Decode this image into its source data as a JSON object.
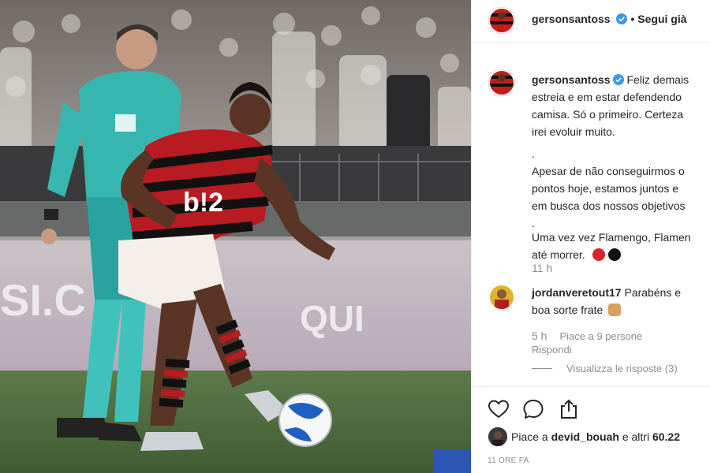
{
  "post": {
    "author": "gersonsantoss",
    "follow_status": "• Segui già",
    "caption_lines": [
      "gersonsantoss",
      "Feliz demais",
      "estreia e em estar defendendo",
      "camisa. Só o primeiro. Certeza",
      "irei evoluir muito.",
      ".",
      "Apesar de não conseguirmos o",
      "pontos hoje, estamos juntos e",
      "em busca dos nossos objetivos",
      ".",
      "Uma vez vez Flamengo, Flamen",
      "até morrer."
    ],
    "caption_time": "11 h",
    "likes_prefix": "Piace a ",
    "likes_user": "devid_bouah",
    "likes_suffix": " e altri ",
    "likes_count": "60.22",
    "posted_ago": "11 ORE FA"
  },
  "comment": {
    "author": "jordanveretout17",
    "text_line1": "Parabéns e",
    "text_line2": "boa sorte frate",
    "time": "5 h",
    "likes": "Piace a 9 persone",
    "reply": "Rispondi",
    "view_replies": "Visualizza le risposte (3)"
  },
  "colors": {
    "verified": "#3897f0",
    "flamengo_red": "#c21e1e",
    "flamengo_black": "#111111",
    "pitch": "#4b6a3d",
    "referee_kit": "#37b6b0"
  },
  "icons": [
    "heart-icon",
    "comment-icon",
    "share-icon",
    "verified-icon"
  ]
}
